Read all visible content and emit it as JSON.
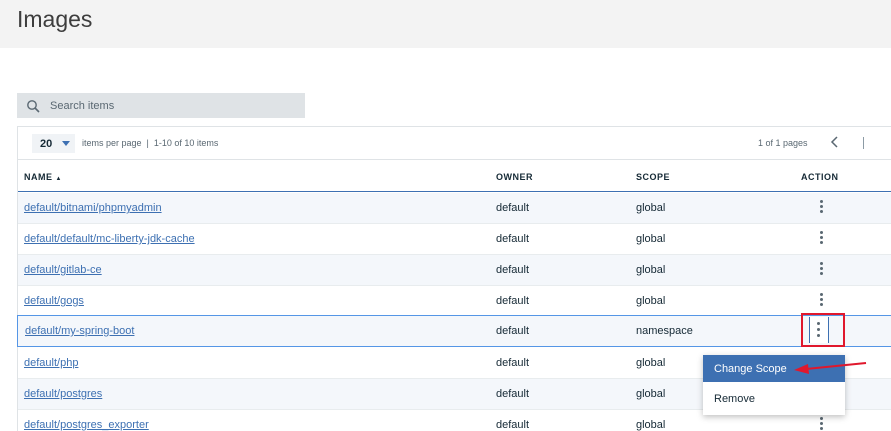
{
  "page": {
    "title": "Images"
  },
  "search": {
    "placeholder": "Search items"
  },
  "pagination": {
    "per_page_value": "20",
    "per_page_label": "items per page  |  1-10 of 10 items",
    "page_info": "1 of 1 pages"
  },
  "table": {
    "columns": {
      "name": "NAME",
      "owner": "OWNER",
      "scope": "SCOPE",
      "action": "ACTION"
    },
    "sort_indicator": "▲",
    "rows": [
      {
        "name": "default/bitnami/phpmyadmin",
        "owner": "default",
        "scope": "global"
      },
      {
        "name": "default/default/mc-liberty-jdk-cache",
        "owner": "default",
        "scope": "global"
      },
      {
        "name": "default/gitlab-ce",
        "owner": "default",
        "scope": "global"
      },
      {
        "name": "default/gogs",
        "owner": "default",
        "scope": "global"
      },
      {
        "name": "default/my-spring-boot",
        "owner": "default",
        "scope": "namespace"
      },
      {
        "name": "default/php",
        "owner": "default",
        "scope": "global"
      },
      {
        "name": "default/postgres",
        "owner": "default",
        "scope": "global"
      },
      {
        "name": "default/postgres_exporter",
        "owner": "default",
        "scope": "global"
      }
    ]
  },
  "menu": {
    "items": [
      "Change Scope",
      "Remove"
    ]
  },
  "colors": {
    "accent": "#3d70b2",
    "highlight": "#e0182d"
  }
}
